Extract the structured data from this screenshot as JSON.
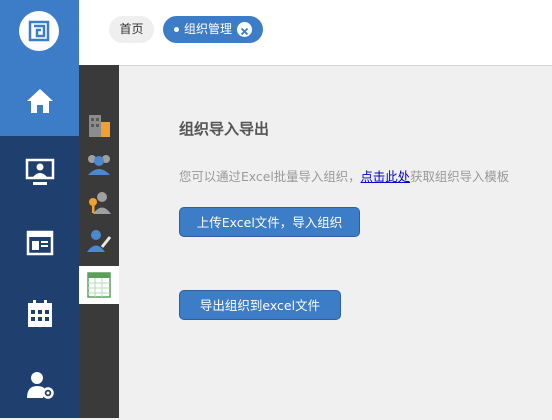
{
  "tabs": {
    "home_label": "首页",
    "org_label": "组织管理"
  },
  "sidebar": {
    "items": [
      {
        "icon": "home-icon",
        "active": true
      },
      {
        "icon": "monitor-user-icon",
        "active": false
      },
      {
        "icon": "news-board-icon",
        "active": false
      },
      {
        "icon": "calendar-icon",
        "active": false
      },
      {
        "icon": "user-settings-icon",
        "active": false
      }
    ]
  },
  "subnav": {
    "items": [
      {
        "icon": "building-icon"
      },
      {
        "icon": "users-group-icon"
      },
      {
        "icon": "user-key-icon"
      },
      {
        "icon": "user-edit-icon"
      },
      {
        "icon": "excel-sheet-icon",
        "active": true
      }
    ]
  },
  "main": {
    "heading": "组织导入导出",
    "desc_before": "您可以通过Excel批量导入组织，",
    "desc_link": "点击此处",
    "desc_after": "获取组织导入模板",
    "import_button": "上传Excel文件，导入组织",
    "export_button": "导出组织到excel文件"
  },
  "colors": {
    "accent": "#3d7cc7",
    "sidebar_bg": "#1f3f6f",
    "subnav_bg": "#3a3a3a"
  }
}
